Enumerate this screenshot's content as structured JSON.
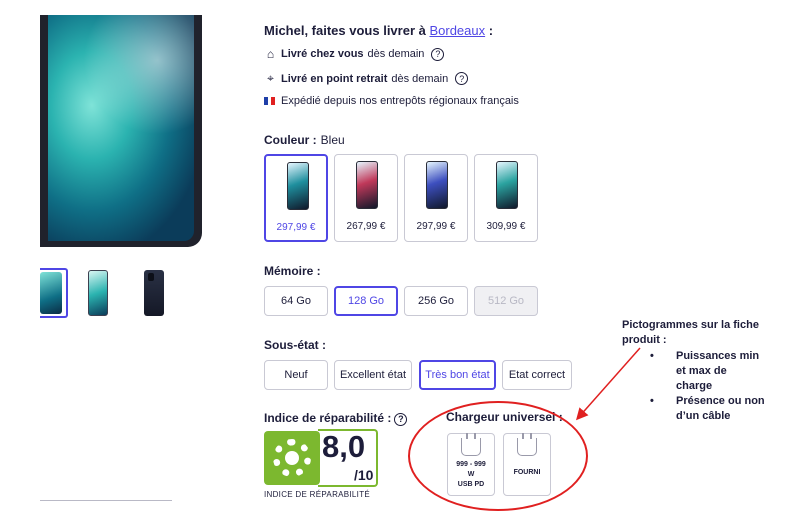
{
  "delivery": {
    "title_prefix": "Michel, faites vous livrer à ",
    "city": "Bordeaux",
    "title_suffix": " :",
    "home_bold": "Livré chez vous",
    "home_rest": "dès demain",
    "pickup_bold": "Livré en point retrait",
    "pickup_rest": "dès demain",
    "shipped": "Expédié depuis nos entrepôts régionaux français"
  },
  "colour": {
    "label": "Couleur :",
    "value": "Bleu",
    "options": [
      {
        "price": "297,99 €",
        "selected": true,
        "tint": "#1f8f9e"
      },
      {
        "price": "267,99 €",
        "selected": false,
        "tint": "#c0395a"
      },
      {
        "price": "297,99 €",
        "selected": false,
        "tint": "#3d4fbf"
      },
      {
        "price": "309,99 €",
        "selected": false,
        "tint": "#2ba3a0"
      }
    ]
  },
  "memory": {
    "label": "Mémoire :",
    "options": [
      "64 Go",
      "128 Go",
      "256 Go",
      "512 Go"
    ]
  },
  "condition": {
    "label": "Sous-état :",
    "options": [
      "Neuf",
      "Excellent état",
      "Très bon état",
      "Etat correct"
    ]
  },
  "repairability": {
    "label": "Indice de réparabilité :",
    "score": "8,0",
    "max": "/10",
    "caption": "INDICE DE RÉPARABILITÉ",
    "score_value": 8.0
  },
  "charger": {
    "label": "Chargeur universel :",
    "power_line1": "999 - 999",
    "power_line2": "W",
    "power_line3": "USB PD",
    "cable": "FOURNI"
  },
  "annotation": {
    "title_line1": "Pictogrammes sur la fiche",
    "title_line2": "produit :",
    "bullet1_line1": "Puissances min",
    "bullet1_line2": "et max de",
    "bullet1_line3": "charge",
    "bullet2_line1": "Présence ou non",
    "bullet2_line2": "d’un câble"
  },
  "colors": {
    "accent": "#4f46e5",
    "repair_green": "#7cb82f",
    "annotation_red": "#e02020"
  }
}
